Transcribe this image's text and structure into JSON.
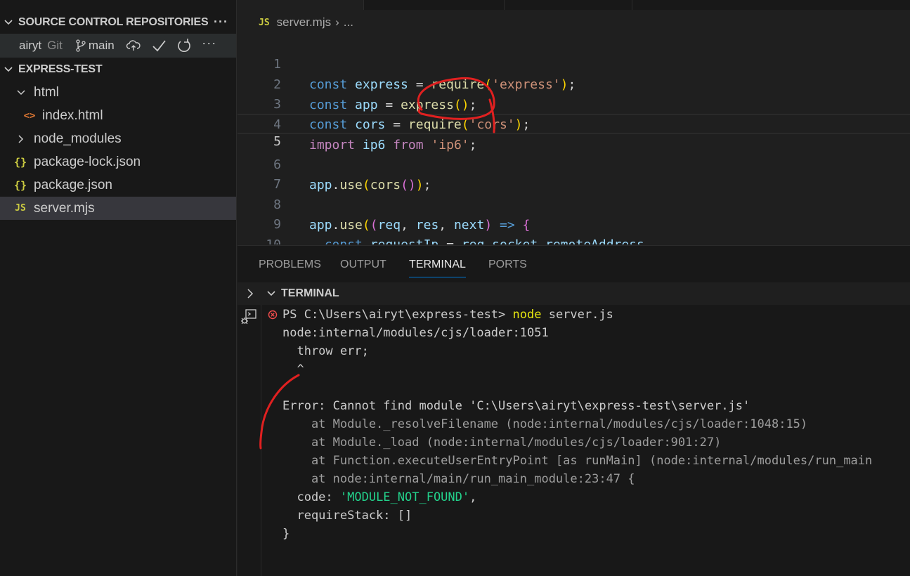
{
  "sidebar": {
    "scm_header": "SOURCE CONTROL REPOSITORIES",
    "repo": {
      "name": "airyt",
      "kind": "Git",
      "branch": "main"
    },
    "explorer_header": "EXPRESS-TEST",
    "files": [
      {
        "label": "html",
        "icon": "chevron-down-icon"
      },
      {
        "label": "index.html",
        "icon": "html-file-icon"
      },
      {
        "label": "node_modules",
        "icon": "chevron-right-icon"
      },
      {
        "label": "package-lock.json",
        "icon": "json-file-icon"
      },
      {
        "label": "package.json",
        "icon": "json-file-icon"
      },
      {
        "label": "server.mjs",
        "icon": "js-file-icon",
        "selected": true
      }
    ]
  },
  "editor": {
    "breadcrumb": {
      "file": "server.mjs",
      "rest": "..."
    },
    "active_line": 5
  },
  "panel": {
    "tabs": [
      "PROBLEMS",
      "OUTPUT",
      "TERMINAL",
      "PORTS"
    ],
    "active_tab": "TERMINAL",
    "terminal_title": "TERMINAL",
    "terminal": {
      "prompt": "PS C:\\Users\\airyt\\express-test> ",
      "command": "node",
      "args": " server.js",
      "line_loader": "node:internal/modules/cjs/loader:1051",
      "line_throw": "  throw err;",
      "line_caret": "  ^",
      "line_error": "Error: Cannot find module 'C:\\Users\\airyt\\express-test\\server.js'",
      "stack": [
        "    at Module._resolveFilename (node:internal/modules/cjs/loader:1048:15)",
        "    at Module._load (node:internal/modules/cjs/loader:901:27)",
        "    at Function.executeUserEntryPoint [as runMain] (node:internal/modules/run_main",
        "    at node:internal/main/run_main_module:23:47 {"
      ],
      "code_key": "  code: ",
      "code_val": "'MODULE_NOT_FOUND'",
      "code_end": ",",
      "require_stack": "  requireStack: []",
      "close_brace": "}"
    }
  },
  "colors": {
    "keyword": "#569cd6",
    "import_keyword": "#c586c0",
    "string": "#ce9178",
    "function": "#dcdcaa",
    "variable": "#9cdcfe",
    "annotation": "#e02020",
    "tab_underline": "#0078d4"
  }
}
